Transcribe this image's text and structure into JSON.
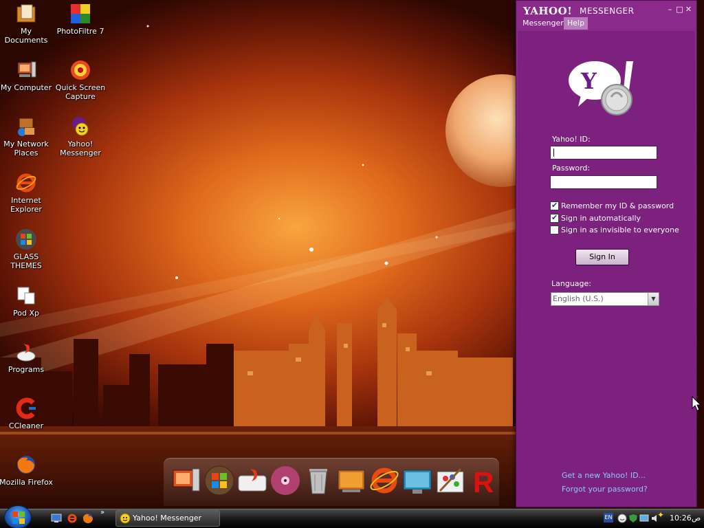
{
  "desktop": {
    "icons": [
      {
        "label": "My Documents",
        "icon": "folder-documents-icon"
      },
      {
        "label": "PhotoFiltre 7",
        "icon": "photofiltre-icon"
      },
      {
        "label": "My Computer",
        "icon": "computer-icon"
      },
      {
        "label": "Quick Screen Capture",
        "icon": "screen-capture-icon"
      },
      {
        "label": "My Network Places",
        "icon": "network-places-icon"
      },
      {
        "label": "Yahoo! Messenger",
        "icon": "yahoo-messenger-icon"
      },
      {
        "label": "Internet Explorer",
        "icon": "internet-explorer-icon"
      },
      {
        "label": "GLASS THEMES",
        "icon": "windows-logo-icon"
      },
      {
        "label": "Pod Xp",
        "icon": "pod-xp-icon"
      },
      {
        "label": "Programs",
        "icon": "programs-icon"
      },
      {
        "label": "CCleaner",
        "icon": "ccleaner-icon"
      },
      {
        "label": "Mozilla Firefox",
        "icon": "firefox-icon"
      }
    ]
  },
  "dock": {
    "items": [
      "computer-dock-icon",
      "windows-dock-icon",
      "disk-dock-icon",
      "dvd-dock-icon",
      "recycle-bin-dock-icon",
      "photo-dock-icon",
      "internet-explorer-dock-icon",
      "monitor-dock-icon",
      "paint-dock-icon",
      "r-app-dock-icon"
    ]
  },
  "messenger": {
    "title_brand": "YAHOO!",
    "title_product": "MESSENGER",
    "menu": [
      "Messenger",
      "Help"
    ],
    "yahoo_id_label": "Yahoo! ID:",
    "yahoo_id_value": "",
    "password_label": "Password:",
    "password_value": "",
    "checkboxes": [
      {
        "label": "Remember my ID & password",
        "checked": true
      },
      {
        "label": "Sign in automatically",
        "checked": true
      },
      {
        "label": "Sign in as invisible to everyone",
        "checked": false
      }
    ],
    "sign_in_label": "Sign In",
    "language_label": "Language:",
    "language_value": "English (U.S.)",
    "link_new_id": "Get a new Yahoo! ID...",
    "link_forgot": "Forgot your password?",
    "accent_color": "#7d217f"
  },
  "taskbar": {
    "task_label": "Yahoo! Messenger",
    "quick_launch": [
      "show-desktop-icon",
      "internet-explorer-icon",
      "firefox-icon"
    ],
    "tray_lang": "EN",
    "clock": "10:26",
    "clock_suffix": "ص"
  }
}
